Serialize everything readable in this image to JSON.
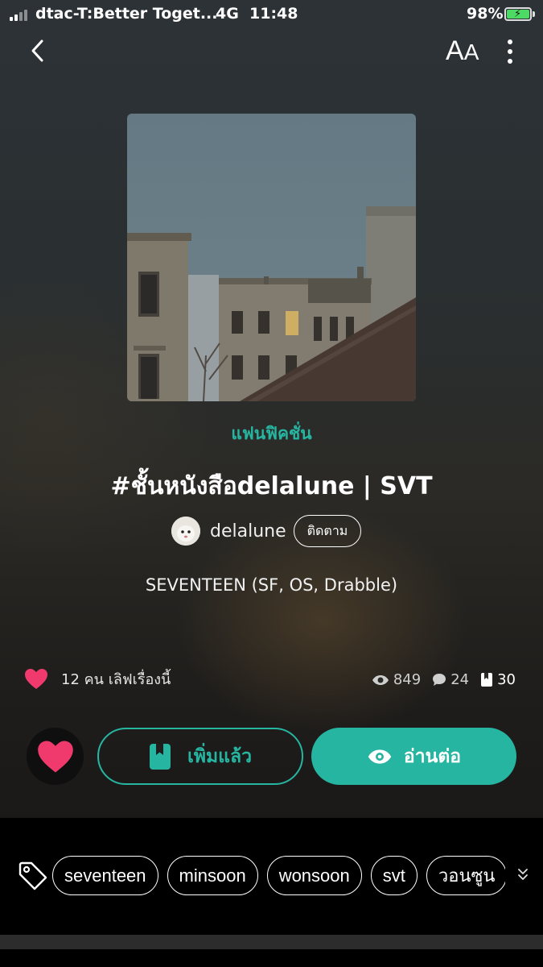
{
  "status_bar": {
    "carrier": "dtac-T:Better Toget...",
    "network": "4G",
    "time": "11:48",
    "battery": "98%"
  },
  "nav": {
    "back_icon": "chevron-left-icon",
    "font_size_label": "AA",
    "more_icon": "vertical-ellipsis-icon"
  },
  "story": {
    "category": "แฟนฟิคชั่น",
    "title": "#ชั้นหนังสือdelalune | SVT",
    "author": "delalune",
    "follow_label": "ติดตาม",
    "subtitle": "SEVENTEEN (SF, OS, Drabble)"
  },
  "engagement": {
    "love_text": "12 คน เลิฟเรื่องนี้",
    "views": "849",
    "comments": "24",
    "chapters": "30"
  },
  "actions": {
    "added_label": "เพิ่มแล้ว",
    "read_label": "อ่านต่อ"
  },
  "tags": [
    "seventeen",
    "minsoon",
    "wonsoon",
    "svt",
    "วอนซูน"
  ],
  "colors": {
    "accent": "#26b5a1",
    "heart": "#f03a6e",
    "battery": "#4cd964"
  }
}
